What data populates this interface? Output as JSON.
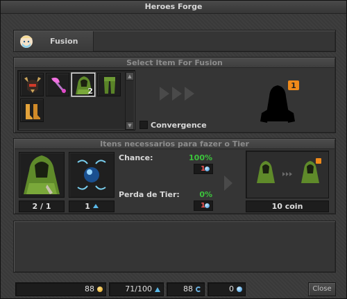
{
  "window": {
    "title": "Heroes Forge"
  },
  "tabs": [
    {
      "label": "Fusion",
      "icon": "portrait-icon"
    }
  ],
  "select_section": {
    "header": "Select Item For Fusion",
    "items": [
      {
        "icon": "demon-helmet-icon",
        "count": ""
      },
      {
        "icon": "pink-axe-icon",
        "count": ""
      },
      {
        "icon": "green-cloak-icon",
        "count": "2",
        "selected": true
      },
      {
        "icon": "green-legs-icon",
        "count": ""
      },
      {
        "icon": "gold-boots-icon",
        "count": ""
      }
    ],
    "convergence_label": "Convergence",
    "preview_tier": "1"
  },
  "requirements_section": {
    "header": "Itens necessarios para fazer o Tier",
    "item_count": "2 / 1",
    "core_count": "1",
    "chance_label": "Chance:",
    "chance_value": "100%",
    "chance_cost": "1",
    "tier_loss_label": "Perda de Tier:",
    "tier_loss_value": "0%",
    "tier_loss_cost": "1",
    "result_cost": "10 coin"
  },
  "footer": {
    "resources": [
      {
        "value": "88",
        "icon": "gold-coin-icon"
      },
      {
        "value": "71/100",
        "icon": "crystal-icon"
      },
      {
        "value": "88",
        "icon": "swirl-icon"
      },
      {
        "value": "0",
        "icon": "blue-gem-icon"
      }
    ],
    "close_label": "Close"
  },
  "colors": {
    "success_green": "#3cc43c",
    "cost_red": "#f05555",
    "tier_badge_orange": "#f08a1a"
  }
}
